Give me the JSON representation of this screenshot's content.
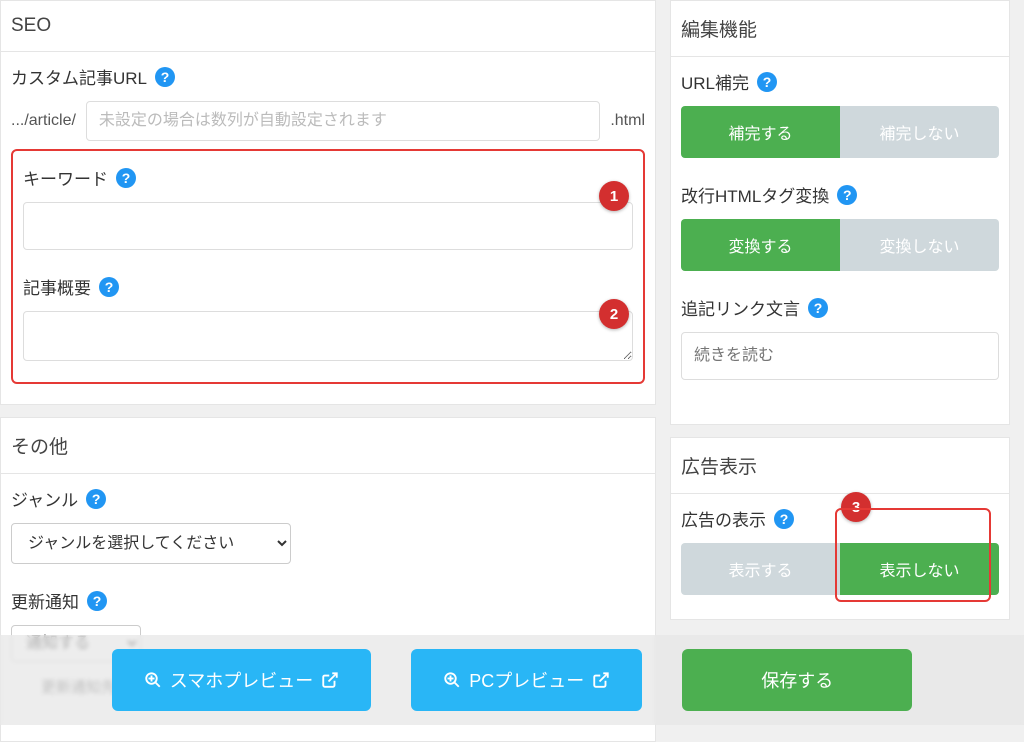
{
  "left": {
    "seo_title": "SEO",
    "custom_url_label": "カスタム記事URL",
    "url_prefix": ".../article/",
    "url_placeholder": "未設定の場合は数列が自動設定されます",
    "url_suffix": ".html",
    "keyword_label": "キーワード",
    "summary_label": "記事概要",
    "other_title": "その他",
    "genre_label": "ジャンル",
    "genre_placeholder": "ジャンルを選択してください",
    "notify_label": "更新通知",
    "notify_value": "通知する",
    "notify_url_label": "更新通知先URL"
  },
  "right": {
    "edit_title": "編集機能",
    "url_complete_label": "URL補完",
    "url_complete_on": "補完する",
    "url_complete_off": "補完しない",
    "html_convert_label": "改行HTMLタグ変換",
    "html_convert_on": "変換する",
    "html_convert_off": "変換しない",
    "readmore_label": "追記リンク文言",
    "readmore_placeholder": "続きを読む",
    "ad_title": "広告表示",
    "ad_display_label": "広告の表示",
    "ad_on": "表示する",
    "ad_off": "表示しない"
  },
  "footer": {
    "preview_sp": "スマホプレビュー",
    "preview_pc": "PCプレビュー",
    "save": "保存する"
  },
  "annotations": {
    "a1": "1",
    "a2": "2",
    "a3": "3"
  }
}
